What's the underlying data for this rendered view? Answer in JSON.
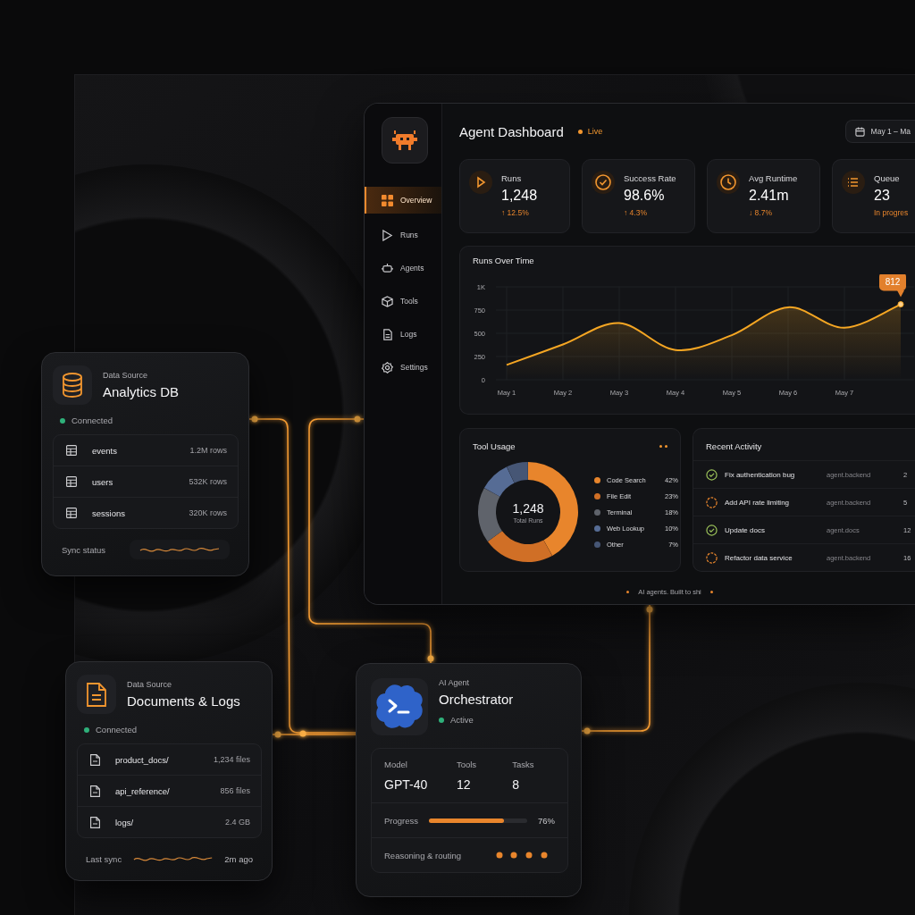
{
  "dashboard": {
    "nav": [
      {
        "label": "Overview",
        "selected": true
      },
      {
        "label": "Runs",
        "selected": false
      },
      {
        "label": "Agents",
        "selected": false
      },
      {
        "label": "Tools",
        "selected": false
      },
      {
        "label": "Logs",
        "selected": false
      },
      {
        "label": "Settings",
        "selected": false
      }
    ],
    "title": "Agent Dashboard",
    "status": "Live",
    "date_range": "May 1 – Ma",
    "kpis": [
      {
        "label": "Runs",
        "value": "1,248",
        "delta": "↑ 12.5%"
      },
      {
        "label": "Success Rate",
        "value": "98.6%",
        "delta": "↑ 4.3%"
      },
      {
        "label": "Avg Runtime",
        "value": "2.41m",
        "delta": "↓ 8.7%"
      },
      {
        "label": "Queue",
        "value": "23",
        "delta": "In progres"
      }
    ],
    "runs_chart": {
      "title": "Runs Over Time",
      "chart_data": {
        "type": "area",
        "categories": [
          "May 1",
          "May 2",
          "May 3",
          "May 4",
          "May 5",
          "May 6",
          "May 7",
          null
        ],
        "values": [
          160,
          380,
          610,
          320,
          480,
          780,
          560,
          812
        ],
        "ylim": [
          0,
          1000
        ],
        "yticks": [
          0,
          250,
          500,
          750,
          {
            "value": 1000,
            "label": "1K"
          }
        ],
        "grid": true,
        "annotations": [
          {
            "text": "812",
            "y": 812
          }
        ]
      }
    },
    "tool_usage": {
      "title": "Tool Usage",
      "total": "1,248",
      "total_label": "Total Runs",
      "legend": [
        {
          "share": "42%",
          "color": "#e8852c"
        },
        {
          "share": "23%",
          "color": "#d06f26"
        },
        {
          "share": "18%",
          "color": "#5f636b"
        },
        {
          "share": "10%",
          "color": "#566c95"
        },
        {
          "share": "7%",
          "color": "#465675"
        }
      ],
      "chart_data": {
        "type": "donut",
        "categories": [
          "Code Search",
          "File Edit",
          "Terminal",
          "Web Lookup",
          "Other"
        ],
        "values": [
          42,
          23,
          18,
          10,
          7
        ]
      }
    },
    "recent_activity": {
      "title": "Recent Activity",
      "items": [
        {
          "title": "Fix authentication bug",
          "agent": "agent.backend",
          "time": "2",
          "done": true
        },
        {
          "title": "Add API rate limiting",
          "agent": "agent.backend",
          "time": "5",
          "done": false
        },
        {
          "title": "Update docs",
          "agent": "agent.docs",
          "time": "12",
          "done": true
        },
        {
          "title": "Refactor data service",
          "agent": "agent.backend",
          "time": "16",
          "done": false
        }
      ]
    },
    "footer": "AI agents. Built to shi"
  },
  "sources": [
    {
      "type_label": "Data Source",
      "name": "Analytics DB",
      "status": "Connected",
      "connected": true,
      "rows": [
        {
          "name": "events",
          "size": "1.2M rows"
        },
        {
          "name": "users",
          "size": "532K rows"
        },
        {
          "name": "sessions",
          "size": "320K rows"
        }
      ],
      "footer_label": "Sync status"
    },
    {
      "type_label": "Data Source",
      "name": "Documents & Logs",
      "status": "Connected",
      "connected": true,
      "rows": [
        {
          "name": "product_docs/",
          "size": "1,234 files"
        },
        {
          "name": "api_reference/",
          "size": "856 files"
        },
        {
          "name": "logs/",
          "size": "2.4 GB"
        }
      ],
      "footer_label": "Last sync",
      "footer_value": "2m ago"
    }
  ],
  "agent": {
    "type_label": "AI Agent",
    "name": "Orchestrator",
    "status": "Active",
    "active": true,
    "stats": [
      {
        "label": "Model",
        "value": "GPT-40"
      },
      {
        "label": "Tools",
        "value": "12"
      },
      {
        "label": "Tasks",
        "value": "8"
      }
    ],
    "progress": {
      "label": "Progress",
      "level": 0.76,
      "reading": "76%"
    },
    "activity": "Reasoning & routing"
  }
}
